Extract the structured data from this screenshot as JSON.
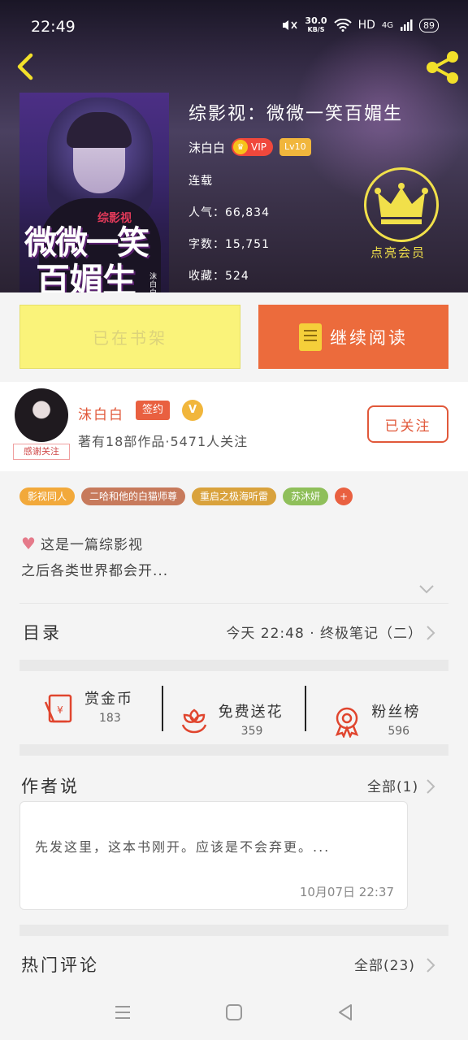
{
  "status_bar": {
    "time": "22:49",
    "net_speed": "30.0",
    "net_unit": "KB/S",
    "network": "HD",
    "signal": "4G",
    "battery": "89"
  },
  "book": {
    "title": "综影视：微微一笑百媚生",
    "cover_title_1": "微微一笑",
    "cover_title_2": "百媚生",
    "cover_tag": "综影视",
    "cover_author": "沫白白",
    "author": "沫白白",
    "vip_label": "VIP",
    "level": "Lv10",
    "status": "连载",
    "popularity_label": "人气：",
    "popularity": "66,834",
    "words_label": "字数：",
    "words": "15,751",
    "favorites_label": "收藏：",
    "favorites": "524"
  },
  "member": {
    "label": "点亮会员"
  },
  "actions": {
    "shelf": "已在书架",
    "read": "继续阅读"
  },
  "author_card": {
    "name": "沫白白",
    "sign_tag": "签约",
    "verified": "V",
    "stats": "著有18部作品·5471人关注",
    "thank_tag": "感谢关注",
    "follow": "已关注"
  },
  "tags": [
    {
      "label": "影视同人",
      "color": "#f2a93b"
    },
    {
      "label": "二哈和他的白猫师尊",
      "color": "#c77a5c"
    },
    {
      "label": "重启之极海听雷",
      "color": "#d9a23c"
    },
    {
      "label": "苏沐妍",
      "color": "#8fbf5a"
    }
  ],
  "tag_more": "+",
  "intro": {
    "line1": "这是一篇综影视",
    "line2": "之后各类世界都会开..."
  },
  "toc": {
    "label": "目录",
    "latest": "今天 22:48 · 终极笔记（二）"
  },
  "stats": [
    {
      "title": "赏金币",
      "value": "183",
      "icon": "red-envelope-icon"
    },
    {
      "title": "免费送花",
      "value": "359",
      "icon": "flower-icon"
    },
    {
      "title": "粉丝榜",
      "value": "596",
      "icon": "medal-icon"
    }
  ],
  "author_note": {
    "title": "作者说",
    "all": "全部(1)",
    "text": "先发这里，这本书刚开。应该是不会弃更。...",
    "date": "10月07日  22:37"
  },
  "comments": {
    "title": "热门评论",
    "all": "全部(23)"
  },
  "colors": {
    "accent": "#ec6b3c",
    "shelf": "#faf37a",
    "member": "#f1e04a"
  }
}
